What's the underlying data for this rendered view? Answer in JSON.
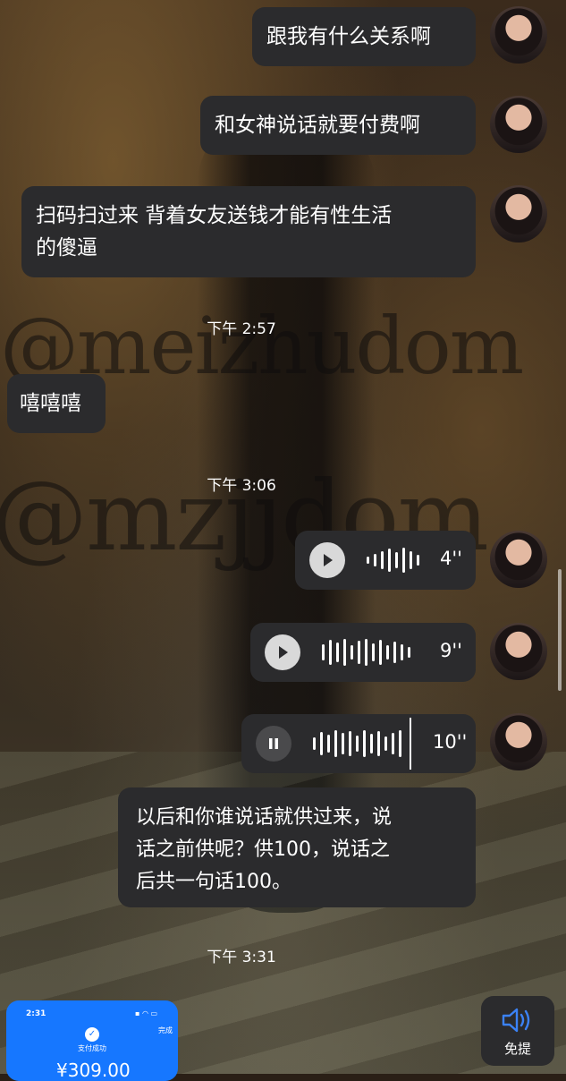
{
  "watermarks": [
    "@meizhudom",
    "@mzjjdom"
  ],
  "messages": {
    "m1": "跟我有什么关系啊",
    "m2": "和女神说话就要付费啊",
    "m3_line1": "扫码扫过来 背着女友送钱才能有性生活",
    "m3_line2": "的傻逼",
    "m4": "嘻嘻嘻",
    "m5_line1": "以后和你谁说话就供过来，说",
    "m5_line2": "话之前供呢？供100，说话之",
    "m5_line3": "后共一句话100。"
  },
  "timestamps": {
    "t1": "下午 2:57",
    "t2": "下午 3:06",
    "t3": "下午 3:31"
  },
  "voice": [
    {
      "duration": "4''",
      "state": "play"
    },
    {
      "duration": "9''",
      "state": "play"
    },
    {
      "duration": "10''",
      "state": "pause"
    }
  ],
  "payment_card": {
    "time": "2:31",
    "done": "完成",
    "status": "支付成功",
    "amount": "¥309.00"
  },
  "speaker": {
    "label": "免提",
    "icon": "speaker-icon"
  }
}
